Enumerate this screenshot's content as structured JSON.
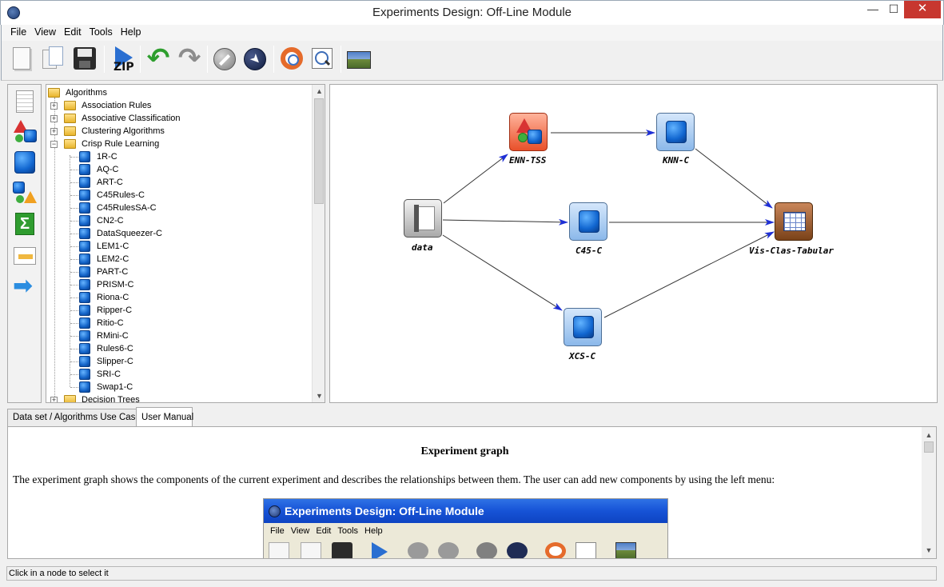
{
  "window": {
    "title": "Experiments Design: Off-Line Module",
    "min": "—",
    "max": "☐",
    "close": "✕"
  },
  "menu": [
    "File",
    "View",
    "Edit",
    "Tools",
    "Help"
  ],
  "tree": {
    "root": "Algorithms",
    "folders": [
      "Association Rules",
      "Associative Classification",
      "Clustering Algorithms",
      "Crisp Rule Learning"
    ],
    "crisp_items": [
      "1R-C",
      "AQ-C",
      "ART-C",
      "C45Rules-C",
      "C45RulesSA-C",
      "CN2-C",
      "DataSqueezer-C",
      "LEM1-C",
      "LEM2-C",
      "PART-C",
      "PRISM-C",
      "Riona-C",
      "Ripper-C",
      "Ritio-C",
      "RMini-C",
      "Rules6-C",
      "Slipper-C",
      "SRI-C",
      "Swap1-C"
    ],
    "last_folder": "Decision Trees"
  },
  "graph": {
    "nodes": {
      "enn": "ENN-TSS",
      "knn": "KNN-C",
      "data": "data",
      "c45": "C45-C",
      "vis": "Vis-Clas-Tabular",
      "xcs": "XCS-C"
    }
  },
  "tabs": [
    "Data set / Algorithms Use Case",
    "User Manual"
  ],
  "manual": {
    "heading": "Experiment graph",
    "text": "The experiment graph shows the components of the current experiment and describes the relationships between them. The user can add new components by using the left menu:",
    "embedded_title": "Experiments Design: Off-Line Module",
    "embedded_menu": [
      "File",
      "View",
      "Edit",
      "Tools",
      "Help"
    ]
  },
  "toolbar": {
    "zip_label": "ZIP"
  },
  "status": "Click in a node to select it",
  "colors": {
    "edge": "#333333",
    "arrowhead": "#1e2fd6"
  }
}
